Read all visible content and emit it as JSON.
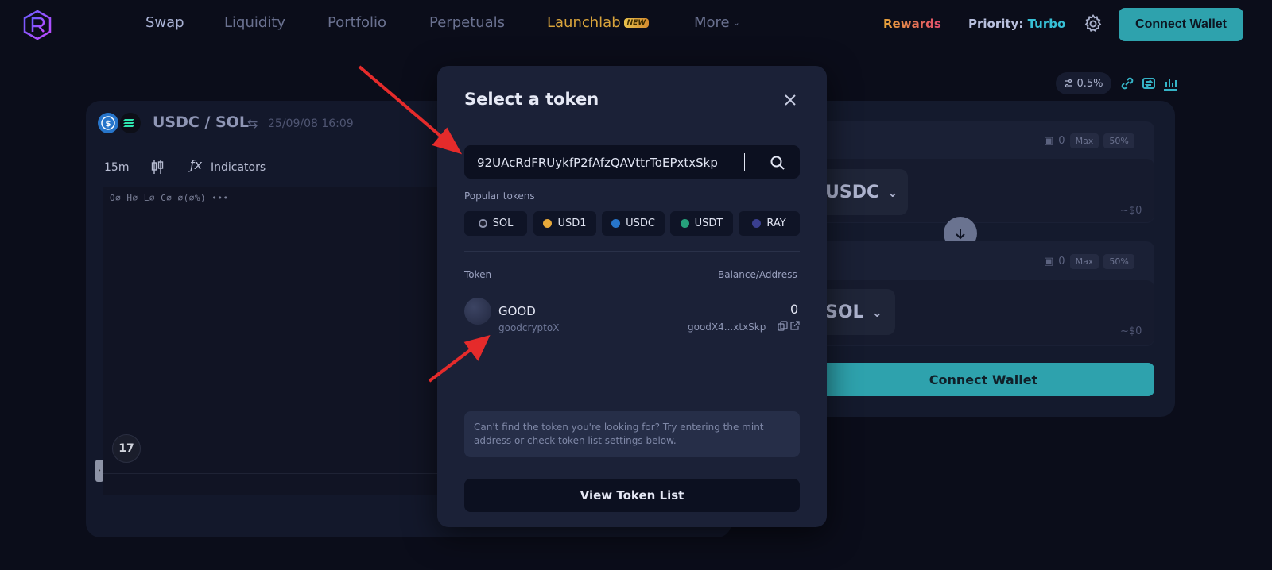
{
  "nav": {
    "items": [
      {
        "label": "Swap",
        "active": true
      },
      {
        "label": "Liquidity"
      },
      {
        "label": "Portfolio"
      },
      {
        "label": "Perpetuals"
      },
      {
        "label": "Launchlab",
        "badge": "NEW"
      },
      {
        "label": "More"
      }
    ],
    "rewards": "Rewards",
    "priority_label": "Priority:",
    "priority_value": "Turbo",
    "connect_wallet": "Connect Wallet"
  },
  "chart": {
    "pair": "USDC / SOL",
    "timestamp": "25/09/08 16:09",
    "timeframe": "15m",
    "indicators": "Indicators",
    "ohlc": "O∅ H∅ L∅ C∅ ∅(∅%)",
    "more": "•••",
    "tv_logo": "17"
  },
  "swap": {
    "slippage": "0.5%",
    "from": {
      "balance": "0",
      "max": "Max",
      "half": "50%",
      "token": "USDC",
      "usd": "~$0"
    },
    "to": {
      "balance": "0",
      "max": "Max",
      "half": "50%",
      "token": "SOL",
      "usd": "~$0"
    },
    "connect_wallet": "Connect Wallet"
  },
  "modal": {
    "title": "Select a token",
    "search_value": "92UAcRdFRUykfP2fAfzQAVttrToEPxtxSkp",
    "popular_label": "Popular tokens",
    "popular": [
      {
        "symbol": "SOL",
        "color": "#1d1f2e"
      },
      {
        "symbol": "USD1",
        "color": "#e7a93a"
      },
      {
        "symbol": "USDC",
        "color": "#2775ca"
      },
      {
        "symbol": "USDT",
        "color": "#26a17b"
      },
      {
        "symbol": "RAY",
        "color": "#3a3f8f"
      }
    ],
    "col_token": "Token",
    "col_balance": "Balance/Address",
    "result": {
      "symbol": "GOOD",
      "name": "goodcryptoX",
      "balance": "0",
      "address": "goodX4...xtxSkp"
    },
    "hint": "Can't find the token you're looking for? Try entering the mint address or check token list settings below.",
    "view_list": "View Token List"
  },
  "colors": {
    "accent": "#2ea2ad",
    "annotation_arrow": "#e52b2b"
  }
}
